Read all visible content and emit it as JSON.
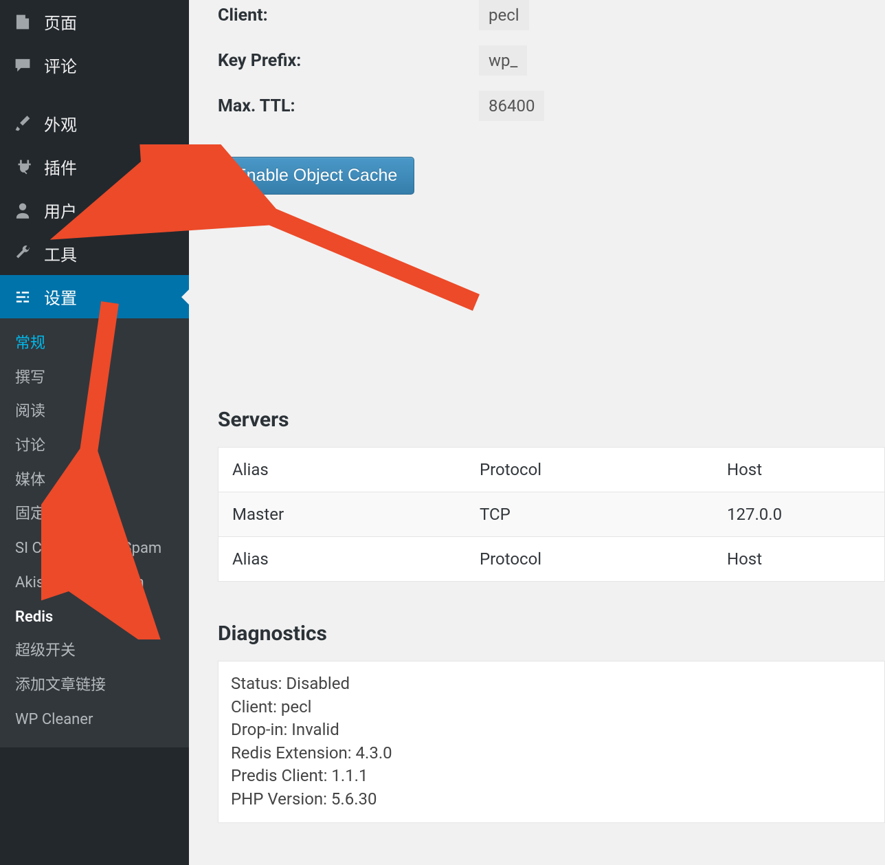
{
  "sidebar": {
    "items": [
      {
        "label": "页面",
        "icon": "pages"
      },
      {
        "label": "评论",
        "icon": "comment"
      },
      {
        "label": "外观",
        "icon": "appearance"
      },
      {
        "label": "插件",
        "icon": "plugins"
      },
      {
        "label": "用户",
        "icon": "users"
      },
      {
        "label": "工具",
        "icon": "tools"
      },
      {
        "label": "设置",
        "icon": "settings"
      }
    ],
    "submenu": [
      "常规",
      "撰写",
      "阅读",
      "讨论",
      "媒体",
      "固定链接",
      "SI Captcha Anti-Spam",
      "Akismet Anti-Spam",
      "Redis",
      "超级开关",
      "添加文章链接",
      "WP Cleaner"
    ]
  },
  "info": {
    "client_label": "Client:",
    "client_value": "pecl",
    "keyprefix_label": "Key Prefix:",
    "keyprefix_value": "wp_",
    "maxttl_label": "Max. TTL:",
    "maxttl_value": "86400"
  },
  "actions": {
    "enable_button": "Enable Object Cache"
  },
  "servers": {
    "heading": "Servers",
    "headers": [
      "Alias",
      "Protocol",
      "Host"
    ],
    "row": [
      "Master",
      "TCP",
      "127.0.0"
    ]
  },
  "diagnostics": {
    "heading": "Diagnostics",
    "lines": [
      "Status: Disabled",
      "Client: pecl",
      "Drop-in: Invalid",
      "Redis Extension: 4.3.0",
      "Predis Client: 1.1.1",
      "PHP Version: 5.6.30"
    ]
  }
}
